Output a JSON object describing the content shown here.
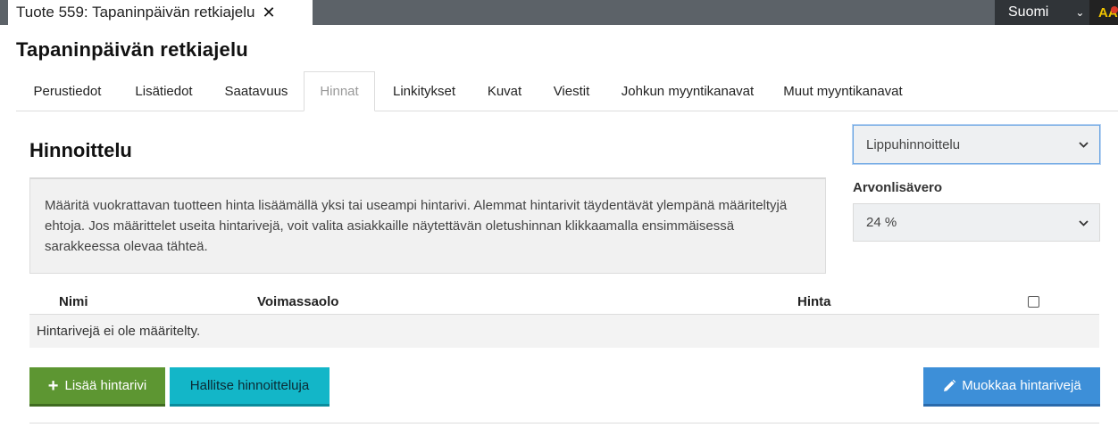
{
  "window": {
    "tab_title": "Tuote 559: Tapaninpäivän retkiajelu",
    "close_glyph": "✕",
    "language": "Suomi",
    "aa": "AA"
  },
  "page": {
    "title": "Tapaninpäivän retkiajelu"
  },
  "tabs": [
    {
      "label": "Perustiedot"
    },
    {
      "label": "Lisätiedot"
    },
    {
      "label": "Saatavuus"
    },
    {
      "label": "Hinnat",
      "active": true
    },
    {
      "label": "Linkitykset"
    },
    {
      "label": "Kuvat"
    },
    {
      "label": "Viestit"
    },
    {
      "label": "Johkun myyntikanavat"
    },
    {
      "label": "Muut myyntikanavat"
    }
  ],
  "pricing": {
    "title": "Hinnoittelu",
    "info": "Määritä vuokrattavan tuotteen hinta lisäämällä yksi tai useampi hintarivi. Alemmat hintarivit täydentävät ylempänä määriteltyjä ehtoja. Jos määrittelet useita hintarivejä, voit valita asiakkaille näytettävän oletushinnan klikkaamalla ensimmäisessä sarakkeessa olevaa tähteä.",
    "type_select": "Lippuhinnoittelu",
    "vat_label": "Arvonlisävero",
    "vat_select": "24 %"
  },
  "table": {
    "headers": {
      "name": "Nimi",
      "validity": "Voimassaolo",
      "price": "Hinta"
    },
    "empty_text": "Hintarivejä ei ole määritelty."
  },
  "buttons": {
    "add": "Lisää hintarivi",
    "manage": "Hallitse hinnoitteluja",
    "edit": "Muokkaa hintarivejä"
  },
  "icons": {
    "close": "close-icon",
    "chevron": "chevron-down-icon",
    "plus": "plus-icon",
    "pencil": "pencil-icon"
  },
  "colors": {
    "topbar": "#5c6268",
    "add_button": "#5d9632",
    "manage_button": "#13b6c8",
    "edit_button": "#3d8fd8"
  }
}
